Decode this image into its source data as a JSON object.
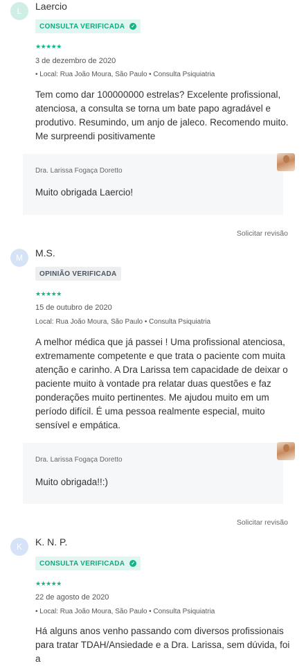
{
  "reviews": [
    {
      "avatar_letter": "L",
      "name": "Laercio",
      "badge": "CONSULTA VERIFICADA",
      "stars": "★★★★★",
      "date": "3 de dezembro de 2020",
      "location": "• Local: Rua João Moura, São Paulo • Consulta Psiquiatria",
      "text": "Tem como dar 100000000 estrelas? Excelente profissional, atenciosa, a consulta se torna um bate papo agradável e produtivo. Resumindo, um anjo de jaleco. Recomendo muito. Me surpreendi positivamente",
      "reply_author": "Dra. Larissa Fogaça Doretto",
      "reply_text": "Muito obrigada Laercio!",
      "request_label": "Solicitar revisão"
    },
    {
      "avatar_letter": "M",
      "name": "M.S.",
      "badge": "OPINIÃO VERIFICADA",
      "stars": "★★★★★",
      "date": "15 de outubro de 2020",
      "location": "Local: Rua João Moura, São Paulo • Consulta Psiquiatria",
      "text": "A melhor médica que já passei ! Uma profissional atenciosa, extremamente competente e que trata o paciente com muita atenção e carinho. A Dra Larissa tem capacidade de deixar o paciente muito à vontade pra relatar duas questões e faz ponderações muito pertinentes. Me ajudou muito em um período difícil. É uma pessoa realmente especial, muito sensível e empática.",
      "reply_author": "Dra. Larissa Fogaça Doretto",
      "reply_text": "Muito obrigada!!:)",
      "request_label": "Solicitar revisão"
    },
    {
      "avatar_letter": "K",
      "name": "K. N. P.",
      "badge": "CONSULTA VERIFICADA",
      "stars": "★★★★★",
      "date": "22 de agosto de 2020",
      "location": "• Local: Rua João Moura, São Paulo • Consulta Psiquiatria",
      "text": "Há alguns anos venho passando com diversos profissionais para tratar TDAH/Ansiedade e a Dra. Larissa, sem dúvida, foi a"
    }
  ],
  "check_glyph": "✓",
  "colors": {
    "accent": "#11b585",
    "badge_green_bg": "#e1f6f0",
    "badge_grey_bg": "#eceef0",
    "reply_bg": "#f6f7f8"
  }
}
